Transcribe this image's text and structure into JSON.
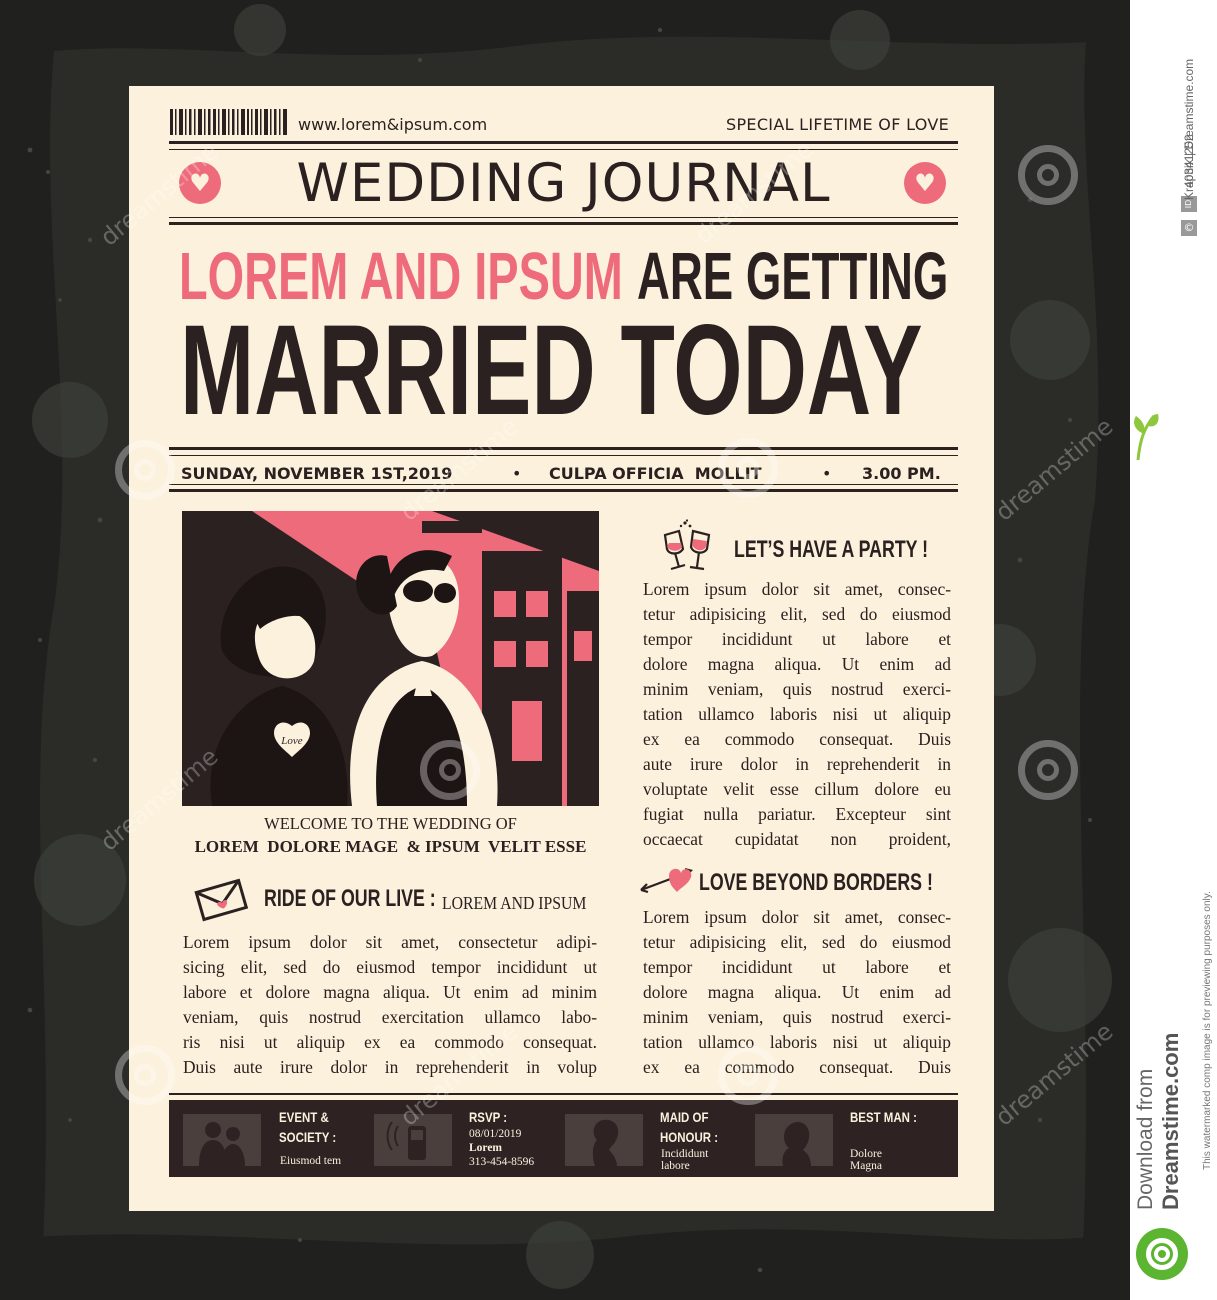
{
  "colors": {
    "accent": "#ee6b7c",
    "ink": "#2a2120",
    "paper": "#fcf1dd",
    "background": "#2b2c28"
  },
  "masthead": {
    "url": "www.lorem&ipsum.com",
    "tagline": "SPECIAL LIFETIME OF LOVE",
    "title": "WEDDING JOURNAL",
    "icons": [
      "heart-icon",
      "heart-icon",
      "barcode-icon"
    ]
  },
  "headline": {
    "names": "LOREM AND IPSUM",
    "line1_rest": "ARE GETTING",
    "line2": "MARRIED TODAY"
  },
  "dateline": {
    "date": "SUNDAY, NOVEMBER 1ST,2019",
    "sep1": "•",
    "place": "CULPA OFFICIA  MOLLIT",
    "sep2": "•",
    "time": "3.00 PM."
  },
  "photo": {
    "caption1": "WELCOME TO THE WEDDING OF",
    "caption2": "LOREM  DOLORE MAGE  & IPSUM  VELIT ESSE",
    "badge": "Love"
  },
  "ride": {
    "heading_bold": "RIDE OF OUR LIVE :",
    "heading_light": "LOREM AND IPSUM",
    "icon": "envelope-icon",
    "lines": [
      "Lorem ipsum dolor sit amet, consectetur adipi-",
      "sicing elit, sed do eiusmod tempor incididunt ut",
      "labore et dolore magna aliqua. Ut enim ad minim",
      "veniam, quis nostrud exercitation ullamco labo-",
      "ris nisi ut aliquip ex ea commodo consequat.",
      "Duis aute irure dolor in reprehenderit in volup"
    ]
  },
  "party": {
    "heading": "LET’S HAVE A PARTY !",
    "icon": "champagne-glasses-icon",
    "lines": [
      "Lorem ipsum dolor sit amet, consec-",
      "tetur adipisicing elit, sed do eiusmod",
      "tempor incididunt ut labore et",
      "dolore magna aliqua. Ut enim ad",
      "minim veniam, quis nostrud exerci-",
      "tation ullamco laboris nisi ut aliquip",
      "ex ea commodo consequat. Duis",
      "aute irure dolor in reprehenderit in",
      "voluptate velit esse cillum dolore eu",
      "fugiat nulla pariatur. Excepteur sint",
      "occaecat cupidatat non proident,"
    ]
  },
  "borders": {
    "heading": "LOVE BEYOND BORDERS !",
    "icon": "heart-arrow-icon",
    "lines": [
      "Lorem ipsum dolor sit amet, consec-",
      "tetur adipisicing elit, sed do eiusmod",
      "tempor incididunt ut labore et",
      "dolore magna aliqua. Ut enim ad",
      "minim veniam, quis nostrud exerci-",
      "tation ullamco laboris nisi ut aliquip",
      "ex ea commodo consequat. Duis"
    ]
  },
  "footer": {
    "event_title1": "EVENT &",
    "event_title2": "SOCIETY :",
    "event_text": "Eiusmod tem",
    "rsvp_title": "RSVP :",
    "rsvp_date": "08/01/2019",
    "rsvp_name": "Lorem",
    "rsvp_phone": "313-454-8596",
    "maid_title1": "MAID OF",
    "maid_title2": "HONOUR :",
    "maid_text1": "Incididunt",
    "maid_text2": "labore",
    "best_title": "BEST MAN :",
    "best_text1": "Dolore",
    "best_text2": "Magna",
    "icons": [
      "couple-silhouette-icon",
      "phone-icon",
      "woman-profile-icon",
      "man-profile-icon"
    ]
  },
  "stock": {
    "id_label": "ID",
    "id_number": "40341252",
    "copyright_symbol": "©",
    "credit": "Kraphix | Dreamstime.com",
    "download": "Download from",
    "site": "Dreamstime.com",
    "notice": "This watermarked comp image is for previewing purposes only.",
    "watermark": "dreamstime"
  }
}
